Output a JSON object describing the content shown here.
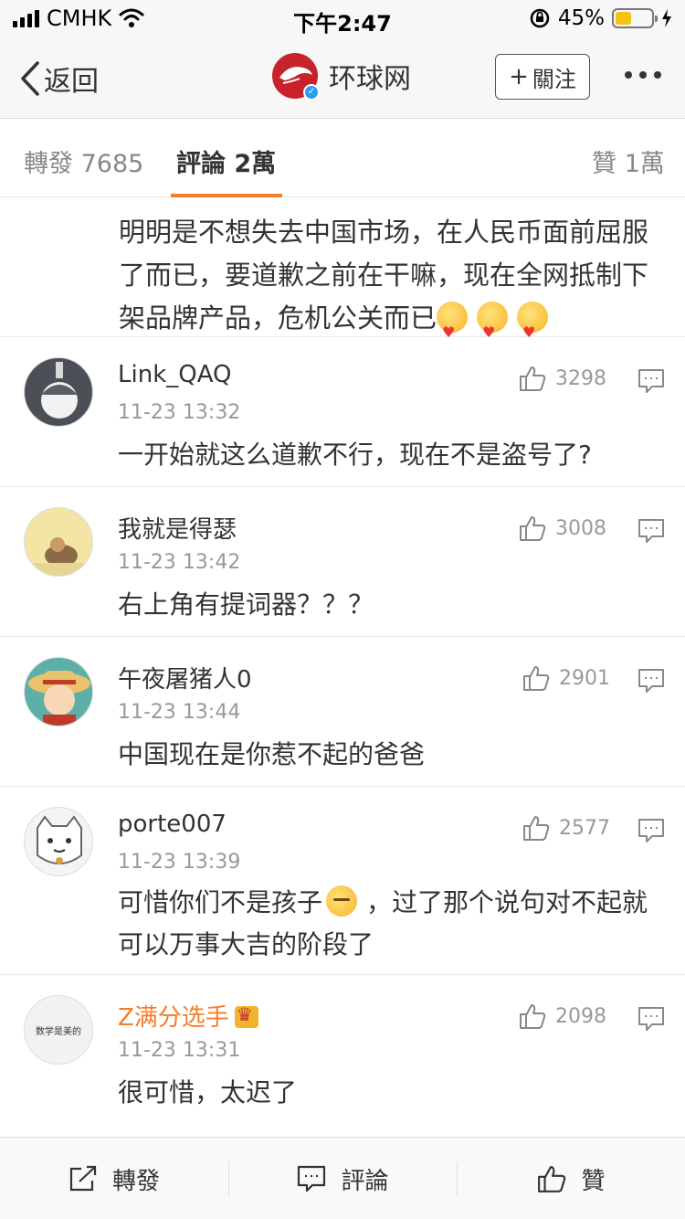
{
  "status_bar": {
    "carrier": "CMHK",
    "time": "下午2:47",
    "battery_pct": "45%",
    "battery_level": 0.45
  },
  "nav": {
    "back_label": "返回",
    "account_name": "环球网",
    "follow_label": "關注",
    "follow_plus": "+"
  },
  "tabs": {
    "repost": "轉發 7685",
    "comment": "評論 2萬",
    "like": "贊 1萬"
  },
  "first_comment": {
    "text": "明明是不想失去中国市场，在人民币面前屈服了而已，要道歉之前在干嘛，现在全网抵制下架品牌产品，危机公关而已"
  },
  "comments": [
    {
      "name": "Link_QAQ",
      "time": "11-23 13:32",
      "likes": "3298",
      "text": "一开始就这么道歉不行，现在不是盗号了?"
    },
    {
      "name": "我就是得瑟",
      "time": "11-23 13:42",
      "likes": "3008",
      "text": "右上角有提词器？？？"
    },
    {
      "name": "午夜屠猪人0",
      "time": "11-23 13:44",
      "likes": "2901",
      "text": "中国现在是你惹不起的爸爸"
    },
    {
      "name": "porte007",
      "time": "11-23 13:39",
      "likes": "2577",
      "text_a": "可惜你们不是孩子",
      "text_b": "，过了那个说句对不起就可以万事大吉的阶段了"
    },
    {
      "name": "Z满分选手",
      "time": "11-23 13:31",
      "likes": "2098",
      "text": "很可惜，太迟了",
      "avatar_text": "数学是美的"
    }
  ],
  "bottom_bar": {
    "repost": "轉發",
    "comment": "評論",
    "like": "贊"
  },
  "colors": {
    "accent": "#f77c28",
    "brand_red": "#c8222b",
    "verify_blue": "#2a9cf6",
    "battery": "#f4c20f"
  }
}
